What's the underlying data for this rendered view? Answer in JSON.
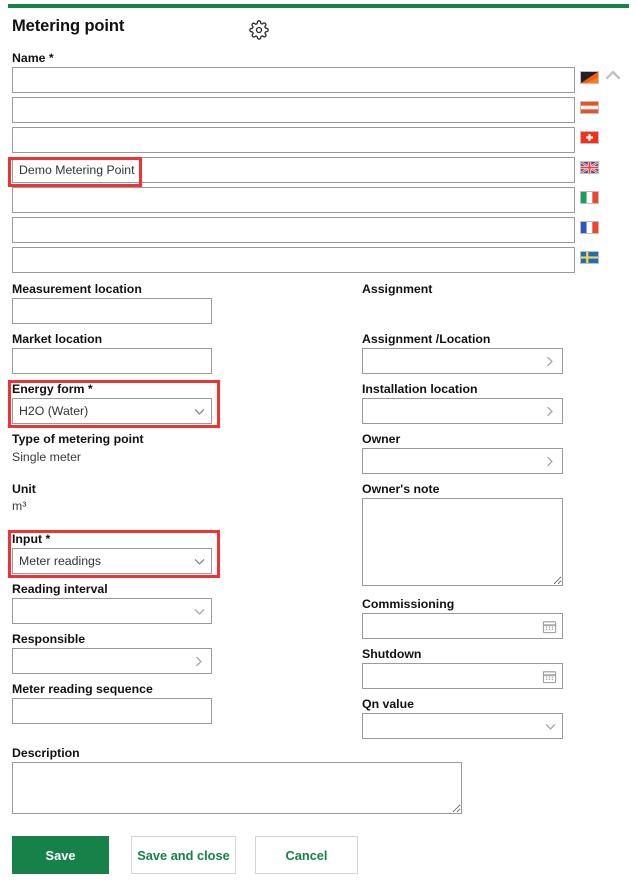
{
  "theme": {
    "accent_green": "#16824a",
    "annotation_red": "#f03232",
    "field_border": "#9a9a9a"
  },
  "header": {
    "title": "Metering point",
    "settings_icon": "gear-icon",
    "collapse_icon": "chevron-up-icon"
  },
  "name_section": {
    "label": "Name *",
    "rows": [
      {
        "language": "German",
        "flag": "flag-de",
        "value": "",
        "placeholder": ""
      },
      {
        "language": "Austrian",
        "flag": "flag-at",
        "value": "",
        "placeholder": ""
      },
      {
        "language": "Swiss",
        "flag": "flag-ch",
        "value": "",
        "placeholder": ""
      },
      {
        "language": "English",
        "flag": "flag-gb",
        "value": "Demo Metering Point",
        "placeholder": ""
      },
      {
        "language": "Italian",
        "flag": "flag-it",
        "value": "",
        "placeholder": ""
      },
      {
        "language": "French",
        "flag": "flag-fr",
        "value": "",
        "placeholder": ""
      },
      {
        "language": "Swedish",
        "flag": "flag-se",
        "value": "",
        "placeholder": ""
      }
    ]
  },
  "left_column": {
    "measurement_location": {
      "label": "Measurement location",
      "value": "",
      "placeholder": ""
    },
    "market_location": {
      "label": "Market location",
      "value": "",
      "placeholder": ""
    },
    "energy_form": {
      "label": "Energy form *",
      "value": "H2O (Water)",
      "icon": "chevron-down-icon"
    },
    "type_of_metering_point": {
      "label": "Type of metering point",
      "value": "Single meter"
    },
    "unit": {
      "label": "Unit",
      "value": "m³"
    },
    "input": {
      "label": "Input *",
      "value": "Meter readings",
      "icon": "chevron-down-icon"
    },
    "reading_interval": {
      "label": "Reading interval",
      "value": "",
      "icon": "chevron-down-icon"
    },
    "responsible": {
      "label": "Responsible",
      "value": "",
      "icon": "chevron-right-icon"
    },
    "meter_reading_sequence": {
      "label": "Meter reading sequence",
      "value": "",
      "placeholder": ""
    }
  },
  "right_column": {
    "section_title": "Assignment",
    "assignment_location": {
      "label": "Assignment /Location",
      "value": "",
      "icon": "chevron-right-icon"
    },
    "installation_location": {
      "label": "Installation location",
      "value": "",
      "icon": "chevron-right-icon"
    },
    "owner": {
      "label": "Owner",
      "value": "",
      "icon": "chevron-right-icon"
    },
    "owners_note": {
      "label": "Owner's note",
      "value": "",
      "placeholder": ""
    },
    "commissioning": {
      "label": "Commissioning",
      "value": "",
      "icon": "calendar-icon"
    },
    "shutdown": {
      "label": "Shutdown",
      "value": "",
      "icon": "calendar-icon"
    },
    "qn_value": {
      "label": "Qn value",
      "value": "",
      "icon": "chevron-down-icon"
    }
  },
  "description": {
    "label": "Description",
    "value": "",
    "placeholder": ""
  },
  "footer": {
    "save": "Save",
    "save_and_close": "Save and close",
    "cancel": "Cancel"
  }
}
